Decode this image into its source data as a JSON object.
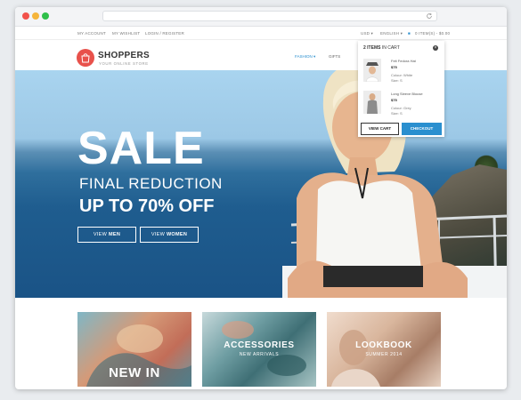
{
  "topbar": {
    "my_account": "MY ACCOUNT",
    "my_wishlist": "MY WISHLIST",
    "login_register": "LOGIN / REGISTER",
    "currency": "USD",
    "language": "ENGLISH",
    "cart_summary": "0 ITEM(S) - $0.00"
  },
  "logo": {
    "name": "SHOPPERS",
    "tagline": "YOUR ONLINE STORE"
  },
  "nav": {
    "fashion": "FASHION",
    "gifts": "GIFTS"
  },
  "hero": {
    "headline": "SALE",
    "subheadline": "FINAL REDUCTION",
    "offer": "UP TO 70% OFF",
    "btn_men_prefix": "VIEW",
    "btn_men_bold": "MEN",
    "btn_women_prefix": "VIEW",
    "btn_women_bold": "WOMEN"
  },
  "cart": {
    "count_text": "2 ITEMS",
    "label_text": "IN CART",
    "items": [
      {
        "name": "Felt Fedora Hat",
        "price": "$75",
        "colour": "Colour: White",
        "size": "Size: S"
      },
      {
        "name": "Long Sleeve Blouse",
        "price": "$75",
        "colour": "Colour: Grey",
        "size": "Size: S"
      }
    ],
    "view_cart": "VIEW CART",
    "checkout": "CHECKOUT"
  },
  "tiles": [
    {
      "title": "NEW IN",
      "subtitle": ""
    },
    {
      "title": "ACCESSORIES",
      "subtitle": "NEW ARRIVALS"
    },
    {
      "title": "LOOKBOOK",
      "subtitle": "SUMMER 2014"
    }
  ],
  "colors": {
    "accent": "#2a8fcf",
    "logo": "#e8514b"
  }
}
